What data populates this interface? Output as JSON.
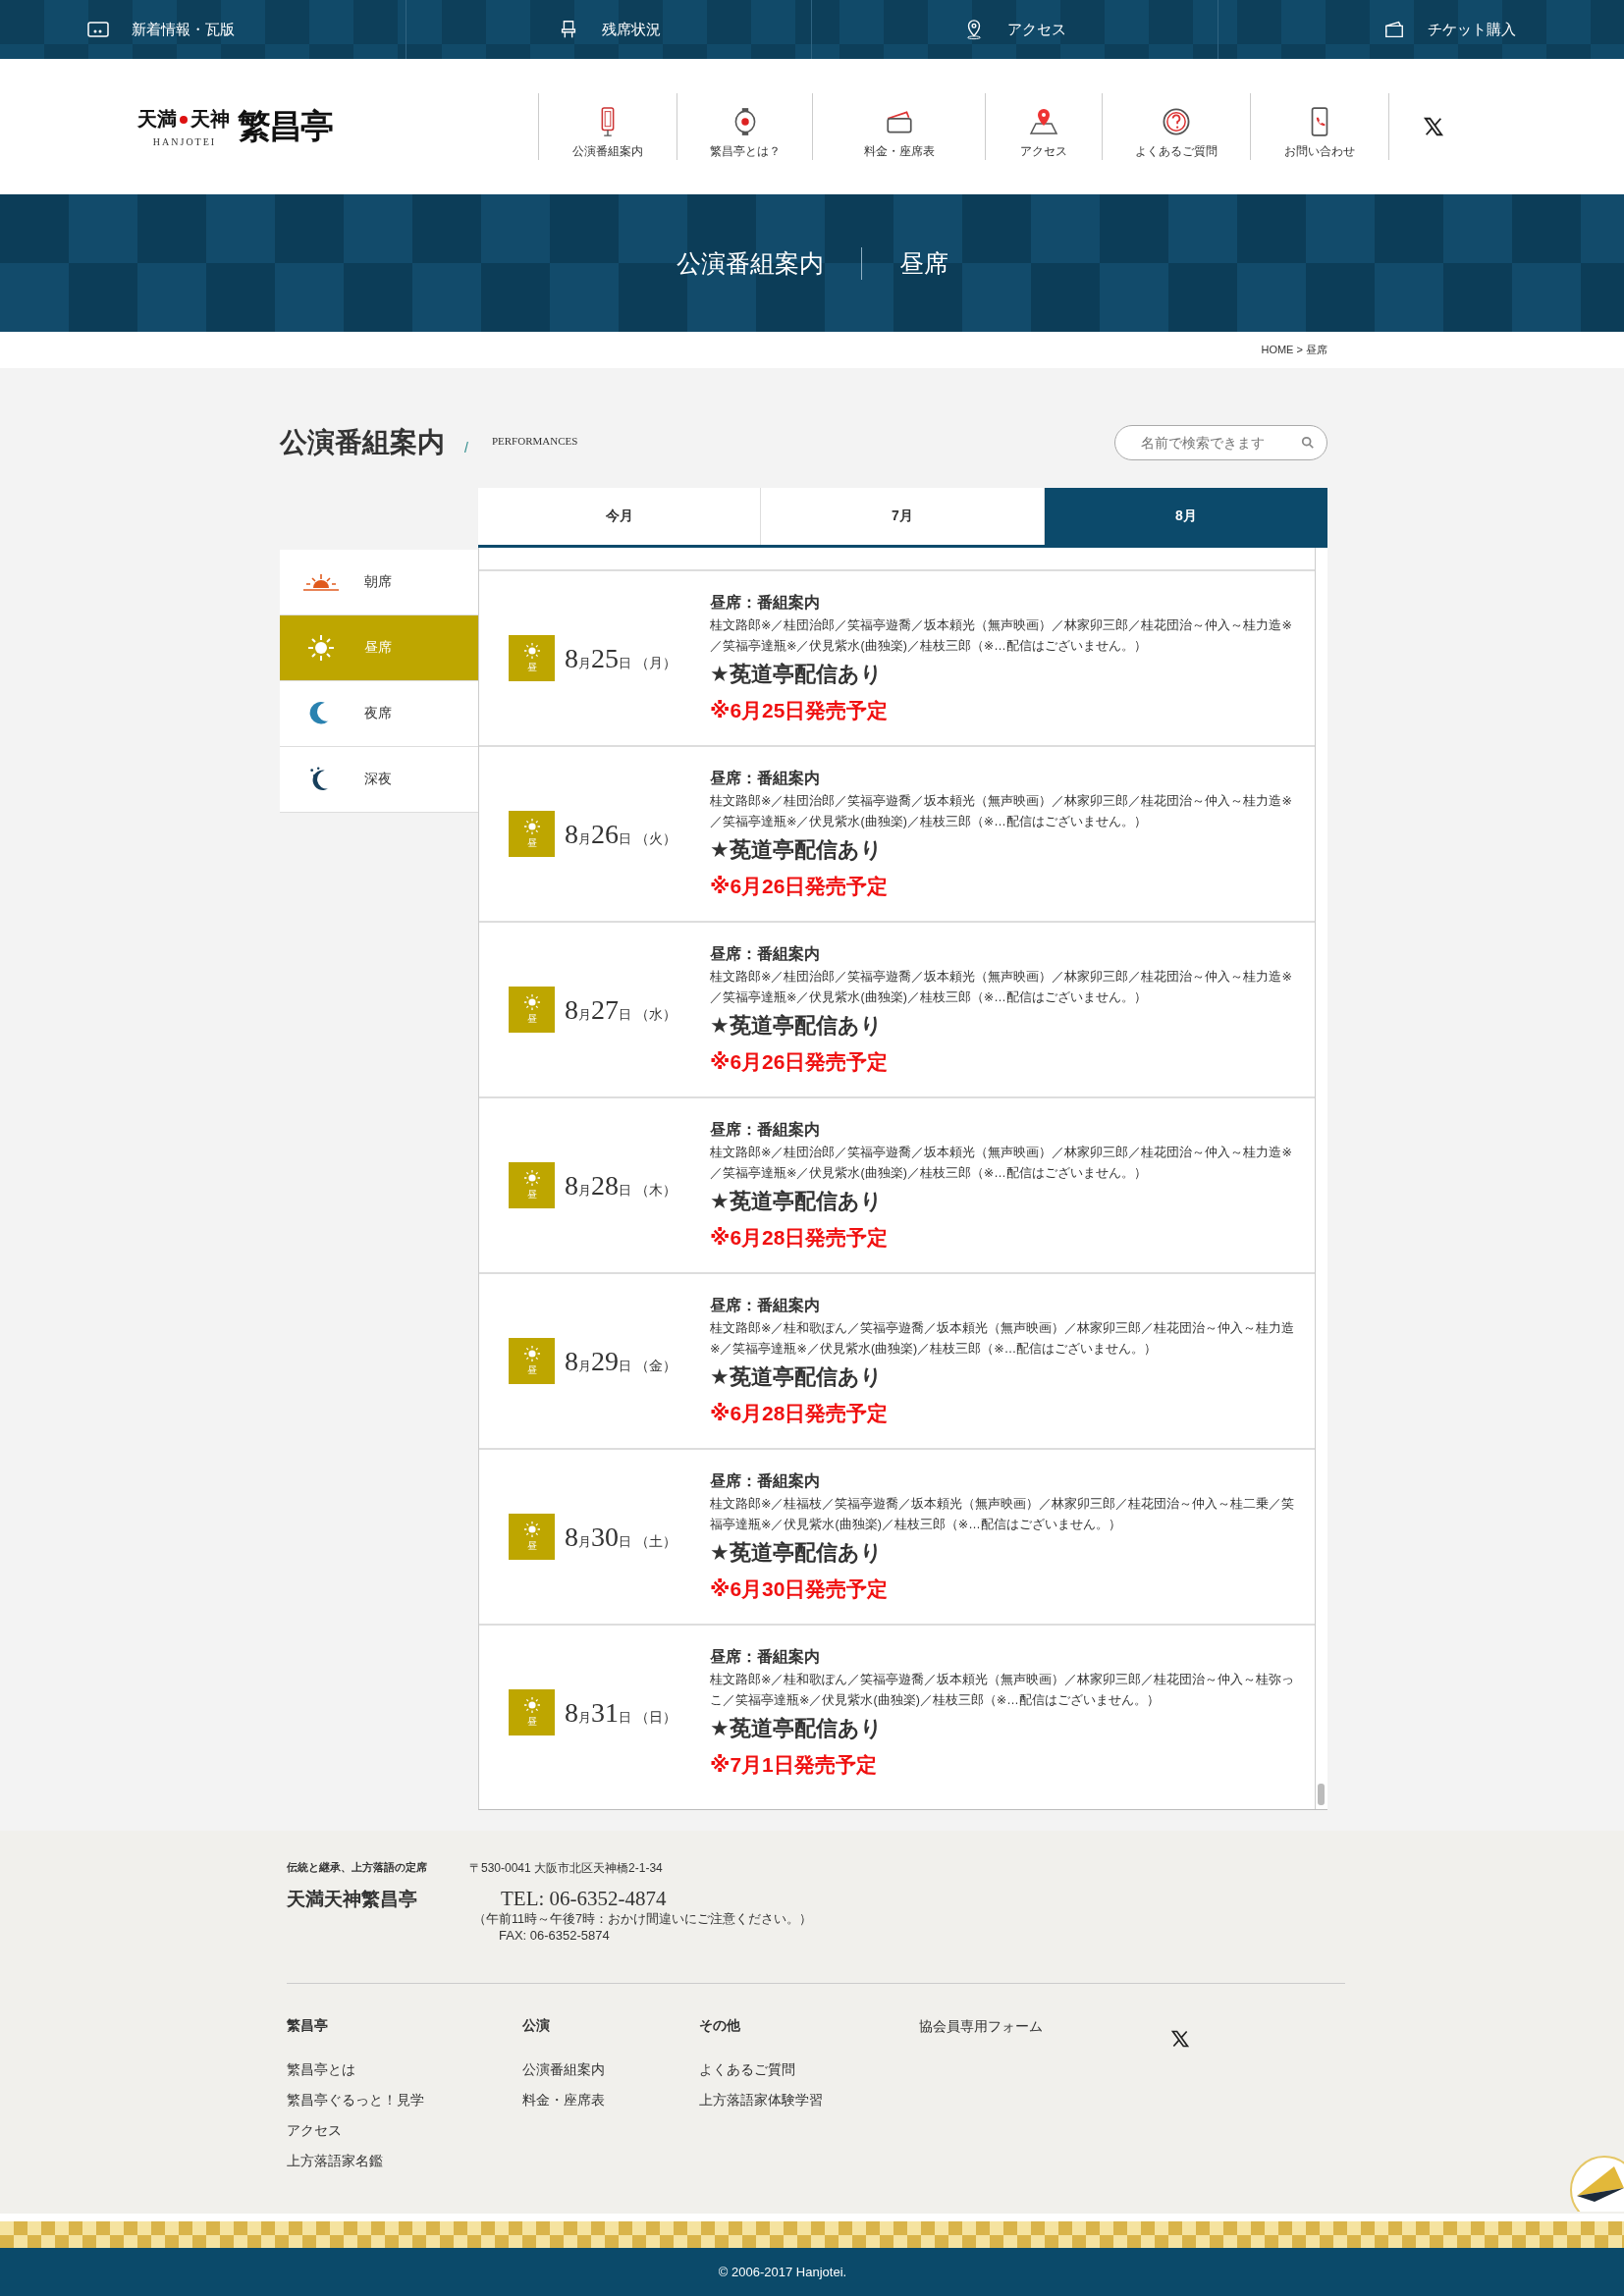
{
  "top_bar": [
    {
      "label": "新着情報・瓦版"
    },
    {
      "label": "残席状況"
    },
    {
      "label": "アクセス"
    },
    {
      "label": "チケット購入"
    }
  ],
  "logo": {
    "left": "天満",
    "right": "天神",
    "romaji": "HANJOTEI",
    "name": "繁昌亭"
  },
  "nav": [
    {
      "label": "公演番組案内"
    },
    {
      "label": "繁昌亭とは？"
    },
    {
      "label": "料金・座席表"
    },
    {
      "label": "アクセス"
    },
    {
      "label": "よくあるご質問"
    },
    {
      "label": "お問い合わせ"
    }
  ],
  "banner": {
    "title": "公演番組案内",
    "subtitle": "昼席"
  },
  "breadcrumb": "HOME > 昼席",
  "heading": {
    "title": "公演番組案内",
    "separator": "/",
    "subtitle": "PERFORMANCES"
  },
  "search": {
    "placeholder": "名前で検索できます"
  },
  "tabs": [
    {
      "label": "今月",
      "selected": false
    },
    {
      "label": "7月",
      "selected": false
    },
    {
      "label": "8月",
      "selected": true
    }
  ],
  "sessions": [
    {
      "label": "朝席",
      "selected": false
    },
    {
      "label": "昼席",
      "selected": true
    },
    {
      "label": "夜席",
      "selected": false
    },
    {
      "label": "深夜",
      "selected": false
    }
  ],
  "entries": [
    {
      "badge": "昼",
      "date": [
        "8",
        "月",
        "25",
        "日",
        "（月）"
      ],
      "title": "昼席：番組案内",
      "performers": "桂文路郎※／桂団治郎／笑福亭遊喬／坂本頼光（無声映画）／林家卯三郎／桂花団治～仲入～桂力造※／笑福亭達瓶※／伏見紫水(曲独楽)／桂枝三郎（※…配信はございません。）",
      "streaming": "★莬道亭配信あり",
      "sale": "※6月25日発売予定"
    },
    {
      "badge": "昼",
      "date": [
        "8",
        "月",
        "26",
        "日",
        "（火）"
      ],
      "title": "昼席：番組案内",
      "performers": "桂文路郎※／桂団治郎／笑福亭遊喬／坂本頼光（無声映画）／林家卯三郎／桂花団治～仲入～桂力造※／笑福亭達瓶※／伏見紫水(曲独楽)／桂枝三郎（※…配信はございません。）",
      "streaming": "★莬道亭配信あり",
      "sale": "※6月26日発売予定"
    },
    {
      "badge": "昼",
      "date": [
        "8",
        "月",
        "27",
        "日",
        "（水）"
      ],
      "title": "昼席：番組案内",
      "performers": "桂文路郎※／桂団治郎／笑福亭遊喬／坂本頼光（無声映画）／林家卯三郎／桂花団治～仲入～桂力造※／笑福亭達瓶※／伏見紫水(曲独楽)／桂枝三郎（※…配信はございません。）",
      "streaming": "★莬道亭配信あり",
      "sale": "※6月26日発売予定"
    },
    {
      "badge": "昼",
      "date": [
        "8",
        "月",
        "28",
        "日",
        "（木）"
      ],
      "title": "昼席：番組案内",
      "performers": "桂文路郎※／桂団治郎／笑福亭遊喬／坂本頼光（無声映画）／林家卯三郎／桂花団治～仲入～桂力造※／笑福亭達瓶※／伏見紫水(曲独楽)／桂枝三郎（※…配信はございません。）",
      "streaming": "★莬道亭配信あり",
      "sale": "※6月28日発売予定"
    },
    {
      "badge": "昼",
      "date": [
        "8",
        "月",
        "29",
        "日",
        "（金）"
      ],
      "title": "昼席：番組案内",
      "performers": "桂文路郎※／桂和歌ぽん／笑福亭遊喬／坂本頼光（無声映画）／林家卯三郎／桂花団治～仲入～桂力造※／笑福亭達瓶※／伏見紫水(曲独楽)／桂枝三郎（※…配信はございません。）",
      "streaming": "★莬道亭配信あり",
      "sale": "※6月28日発売予定"
    },
    {
      "badge": "昼",
      "date": [
        "8",
        "月",
        "30",
        "日",
        "（土）"
      ],
      "title": "昼席：番組案内",
      "performers": "桂文路郎※／桂福枝／笑福亭遊喬／坂本頼光（無声映画）／林家卯三郎／桂花団治～仲入～桂二乗／笑福亭達瓶※／伏見紫水(曲独楽)／桂枝三郎（※…配信はございません。）",
      "streaming": "★莬道亭配信あり",
      "sale": "※6月30日発売予定"
    },
    {
      "badge": "昼",
      "date": [
        "8",
        "月",
        "31",
        "日",
        "（日）"
      ],
      "title": "昼席：番組案内",
      "performers": "桂文路郎※／桂和歌ぽん／笑福亭遊喬／坂本頼光（無声映画）／林家卯三郎／桂花団治～仲入～桂弥っこ／笑福亭達瓶※／伏見紫水(曲独楽)／桂枝三郎（※…配信はございません。）",
      "streaming": "★莬道亭配信あり",
      "sale": "※7月1日発売予定"
    }
  ],
  "footer": {
    "tagline": "伝統と継承、上方落語の定席",
    "name": "天満天神繁昌亭",
    "address": "〒530-0041 大阪市北区天神橋2-1-34",
    "tel": "TEL: 06-6352-4874",
    "hours": "（午前11時～午後7時：おかけ間違いにご注意ください。）",
    "fax": "FAX: 06-6352-5874",
    "columns": [
      {
        "heading": "繁昌亭",
        "links": [
          "繁昌亭とは",
          "繁昌亭ぐるっと！見学",
          "アクセス",
          "上方落語家名鑑"
        ]
      },
      {
        "heading": "公演",
        "links": [
          "公演番組案内",
          "料金・座席表"
        ]
      },
      {
        "heading": "その他",
        "links": [
          "よくあるご質問",
          "上方落語家体験学習"
        ]
      }
    ],
    "member_form": "協会員専用フォーム",
    "copyright": "© 2006-2017 Hanjotei."
  }
}
